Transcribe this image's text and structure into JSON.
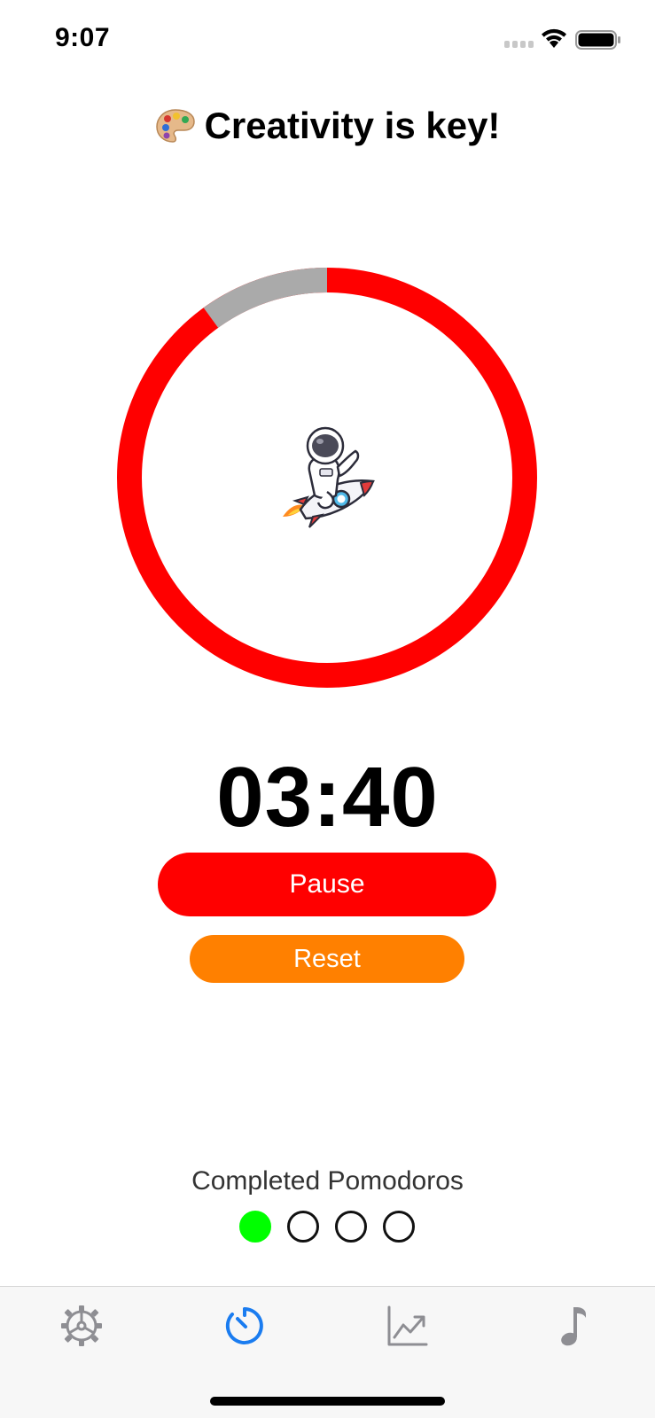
{
  "status_bar": {
    "time": "9:07"
  },
  "header": {
    "emoji_icon": "palette-icon",
    "title": "Creativity is key!"
  },
  "progress": {
    "fraction_elapsed": 0.1,
    "colors": {
      "remaining": "#ff0000",
      "elapsed": "#aaaaaa"
    },
    "center_image": "astronaut-on-rocket"
  },
  "timer": {
    "display": "03:40"
  },
  "buttons": {
    "pause_label": "Pause",
    "pause_color": "#ff0000",
    "reset_label": "Reset",
    "reset_color": "#ff8000"
  },
  "pomodoros": {
    "label": "Completed Pomodoros",
    "completed": 1,
    "total": 4,
    "completed_color": "#00ff00"
  },
  "tab_bar": {
    "tabs": [
      {
        "icon": "gear-icon",
        "active": false
      },
      {
        "icon": "timer-icon",
        "active": true
      },
      {
        "icon": "chart-icon",
        "active": false
      },
      {
        "icon": "music-note-icon",
        "active": false
      }
    ],
    "active_color": "#1a7cf0",
    "inactive_color": "#8e8e93"
  }
}
